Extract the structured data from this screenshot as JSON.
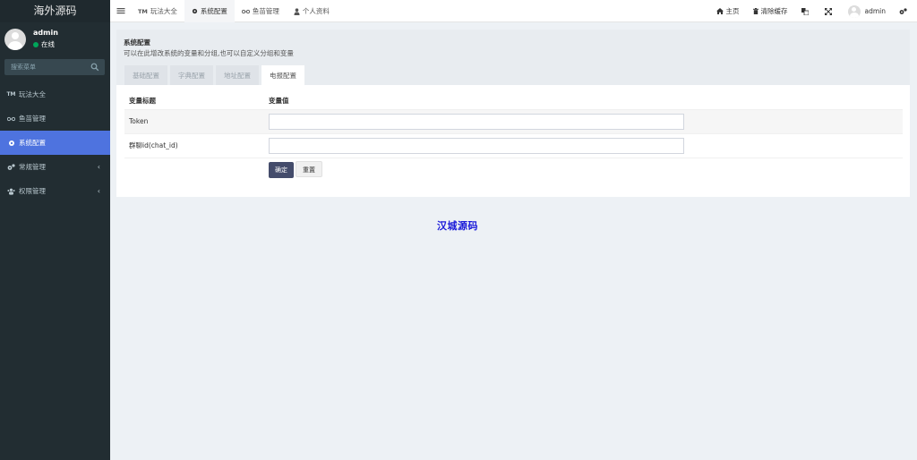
{
  "app": {
    "brand": "海外源码"
  },
  "sidebar": {
    "user": {
      "name": "admin",
      "status": "在线"
    },
    "search_placeholder": "搜索菜单",
    "items": [
      {
        "icon": "tm-icon",
        "icon_text": "TM",
        "label": "玩法大全"
      },
      {
        "icon": "glasses-icon",
        "label": "鱼苗管理"
      },
      {
        "icon": "gear-icon",
        "label": "系统配置",
        "active": true
      },
      {
        "icon": "cogs-icon",
        "label": "常规管理",
        "has_children": true
      },
      {
        "icon": "users-icon",
        "label": "权限管理",
        "has_children": true
      }
    ],
    "chevron": "‹"
  },
  "header": {
    "tabs": [
      {
        "icon": "tm-icon",
        "icon_text": "TM",
        "label": "玩法大全"
      },
      {
        "icon": "gear-icon",
        "label": "系统配置",
        "active": true
      },
      {
        "icon": "glasses-icon",
        "label": "鱼苗管理"
      },
      {
        "icon": "user-icon",
        "label": "个人资料"
      }
    ],
    "right": {
      "home": "主页",
      "clear_cache": "清除缓存",
      "username": "admin"
    }
  },
  "panel": {
    "title": "系统配置",
    "description": "可以在此增改系统的变量和分组,也可以自定义分组和变量",
    "tabs": [
      "基础配置",
      "字典配置",
      "地址配置",
      "电报配置"
    ],
    "active_tab": "电报配置",
    "table": {
      "headers": [
        "变量标题",
        "变量值"
      ],
      "rows": [
        {
          "label": "Token",
          "value": ""
        },
        {
          "label": "群聊id(chat_id)",
          "value": ""
        }
      ]
    },
    "buttons": {
      "ok": "确定",
      "reset": "重置"
    }
  },
  "watermark": "汉城源码",
  "colors": {
    "sidebar_bg": "#222d32",
    "sidebar_active": "#4e73df",
    "status_online": "#00a65a",
    "primary_button": "#444c6b",
    "watermark": "#1a1ad9"
  }
}
